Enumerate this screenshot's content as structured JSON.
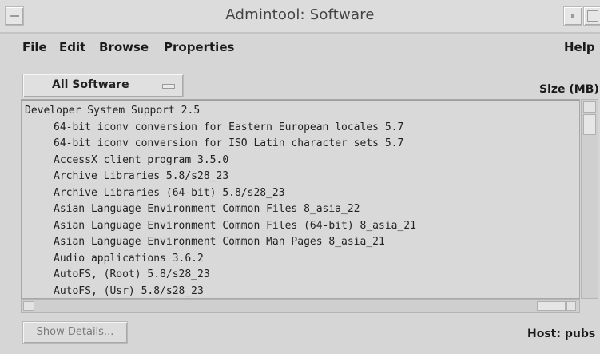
{
  "window": {
    "title": "Admintool: Software"
  },
  "menubar": {
    "file": "File",
    "edit": "Edit",
    "browse": "Browse",
    "properties": "Properties",
    "help": "Help"
  },
  "filter": {
    "selected": "All Software"
  },
  "list": {
    "size_header": "Size (MB)",
    "items": [
      "Developer System Support 2.5",
      "64-bit iconv conversion for Eastern European locales 5.7",
      "64-bit iconv conversion for ISO Latin character sets 5.7",
      "AccessX client program 3.5.0",
      "Archive Libraries 5.8/s28_23",
      "Archive Libraries (64-bit) 5.8/s28_23",
      "Asian Language Environment Common Files 8_asia_22",
      "Asian Language Environment Common Files (64-bit) 8_asia_21",
      "Asian Language Environment Common Man Pages 8_asia_21",
      "Audio applications 3.6.2",
      "AutoFS, (Root) 5.8/s28_23",
      "AutoFS, (Usr) 5.8/s28_23"
    ]
  },
  "footer": {
    "details_button": "Show Details...",
    "host": "Host: pubs"
  }
}
